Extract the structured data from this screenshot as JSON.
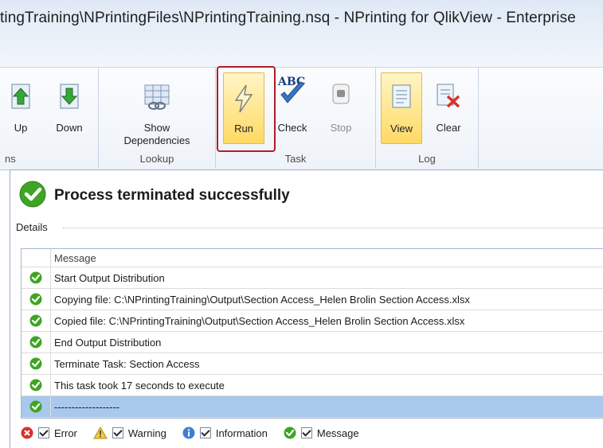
{
  "window": {
    "title": "tingTraining\\NPrintingFiles\\NPrintingTraining.nsq - NPrinting for QlikView - Enterprise"
  },
  "ribbon": {
    "groups": {
      "order": {
        "label": "ns",
        "up": "Up",
        "down": "Down"
      },
      "lookup": {
        "label": "Lookup",
        "show_dependencies": "Show\nDependencies"
      },
      "task": {
        "label": "Task",
        "run": "Run",
        "check": "Check",
        "stop": "Stop"
      },
      "log": {
        "label": "Log",
        "view": "View",
        "clear": "Clear"
      }
    }
  },
  "status": {
    "text": "Process terminated successfully"
  },
  "details": {
    "label": "Details"
  },
  "log_table": {
    "header": "Message",
    "rows": [
      {
        "icon": "success-check-icon",
        "message": "Start Output Distribution"
      },
      {
        "icon": "success-check-icon",
        "message": "Copying file: C:\\NPrintingTraining\\Output\\Section Access_Helen Brolin Section Access.xlsx"
      },
      {
        "icon": "success-check-icon",
        "message": "Copied file: C:\\NPrintingTraining\\Output\\Section Access_Helen Brolin Section Access.xlsx"
      },
      {
        "icon": "success-check-icon",
        "message": "End Output Distribution"
      },
      {
        "icon": "success-check-icon",
        "message": "Terminate Task: Section Access"
      },
      {
        "icon": "success-check-icon",
        "message": "This task took 17 seconds to execute"
      },
      {
        "icon": "success-check-icon",
        "message": "-------------------"
      }
    ]
  },
  "filters": {
    "error": "Error",
    "warning": "Warning",
    "information": "Information",
    "message": "Message"
  },
  "colors": {
    "accent": "#ffd964",
    "run_highlight": "#b11c2a",
    "success": "#3ea524",
    "selection": "#a8c8ec"
  }
}
